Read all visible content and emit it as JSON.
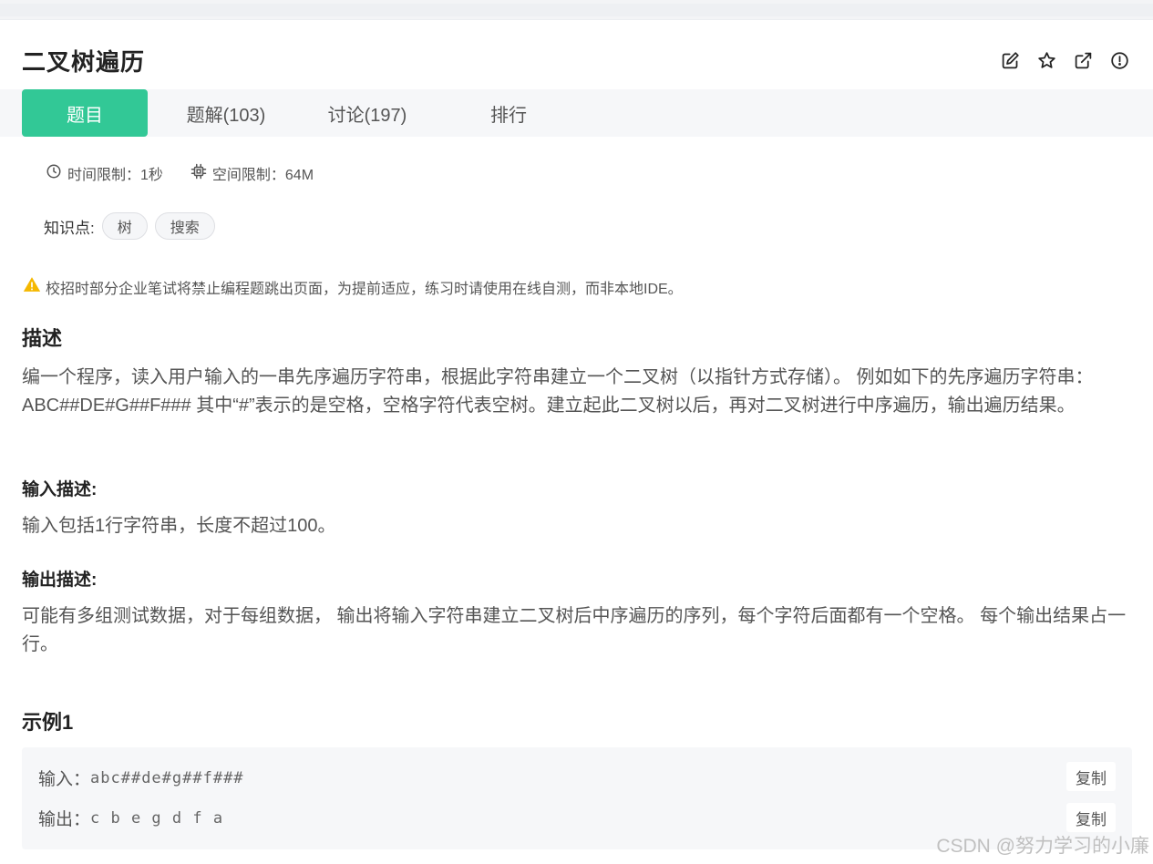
{
  "page_title": "二叉树遍历",
  "tabs": [
    {
      "label": "题目"
    },
    {
      "label": "题解(103)"
    },
    {
      "label": "讨论(197)"
    },
    {
      "label": "排行"
    }
  ],
  "limits": {
    "time": "时间限制：1秒",
    "space": "空间限制：64M"
  },
  "knowledge": {
    "label": "知识点:",
    "tags": [
      "树",
      "搜索"
    ]
  },
  "warning": "校招时部分企业笔试将禁止编程题跳出页面，为提前适应，练习时请使用在线自测，而非本地IDE。",
  "description": {
    "heading": "描述",
    "text": "编一个程序，读入用户输入的一串先序遍历字符串，根据此字符串建立一个二叉树（以指针方式存储）。 例如如下的先序遍历字符串： ABC##DE#G##F### 其中“#”表示的是空格，空格字符代表空树。建立起此二叉树以后，再对二叉树进行中序遍历，输出遍历结果。"
  },
  "input_desc": {
    "heading": "输入描述:",
    "text": "输入包括1行字符串，长度不超过100。"
  },
  "output_desc": {
    "heading": "输出描述:",
    "text": "可能有多组测试数据，对于每组数据， 输出将输入字符串建立二叉树后中序遍历的序列，每个字符后面都有一个空格。 每个输出结果占一行。"
  },
  "example": {
    "heading": "示例1",
    "input_label": "输入：",
    "input_value": "abc##de#g##f###",
    "output_label": "输出：",
    "output_value": "c b e g d f a",
    "copy_label": "复制"
  },
  "watermark": "CSDN @努力学习的小廉",
  "icons": {
    "edit": "edit-icon",
    "star": "star-icon",
    "share": "external-link-icon",
    "report": "alert-circle-icon",
    "clock": "clock-icon",
    "chip": "chip-icon",
    "warning": "warning-triangle-icon"
  },
  "colors": {
    "accent": "#32c896",
    "warning": "#f5b800"
  }
}
